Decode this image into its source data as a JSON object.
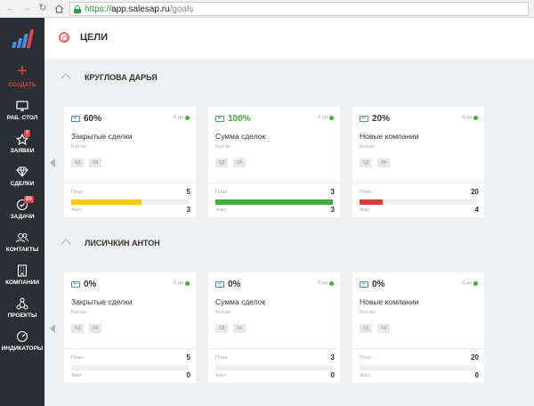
{
  "browser": {
    "url_scheme": "https://",
    "url_host": "app.salesap.ru",
    "url_path": "/goals"
  },
  "sidebar": {
    "create_label": "СОЗДАТЬ",
    "items": [
      {
        "label": "РАБ. СТОЛ",
        "icon": "monitor-icon"
      },
      {
        "label": "ЗАЯВКИ",
        "icon": "star-icon",
        "badge": "7"
      },
      {
        "label": "СДЕЛКИ",
        "icon": "diamond-icon"
      },
      {
        "label": "ЗАДАЧИ",
        "icon": "check-circle-icon",
        "badge": "85"
      },
      {
        "label": "КОНТАКТЫ",
        "icon": "users-icon"
      },
      {
        "label": "КОМПАНИИ",
        "icon": "building-icon"
      },
      {
        "label": "ПРОЕКТЫ",
        "icon": "projects-icon"
      },
      {
        "label": "ИНДИКАТОРЫ",
        "icon": "gauge-icon"
      }
    ]
  },
  "page": {
    "title": "ЦЕЛИ"
  },
  "sections": [
    {
      "name": "КРУГЛОВА ДАРЬЯ",
      "cards": [
        {
          "percent": "60%",
          "percent_color": "#333333",
          "period": "8 дн",
          "name": "Закрытые сделки",
          "unit": "Кол-во",
          "tags": [
            "ХД",
            "ЛА"
          ],
          "plan_label": "План",
          "plan": "5",
          "fact_label": "Факт",
          "fact": "3",
          "progress": 0.6,
          "bar_color": "#f5c518"
        },
        {
          "percent": "100%",
          "percent_color": "#3fae3c",
          "period": "8 дн",
          "name": "Сумма сделок",
          "unit": "Кол-во",
          "tags": [
            "ХД",
            "ЛА"
          ],
          "plan_label": "План",
          "plan": "3",
          "fact_label": "Факт",
          "fact": "3",
          "progress": 1.0,
          "bar_color": "#3fae3c"
        },
        {
          "percent": "20%",
          "percent_color": "#333333",
          "period": "8 дн",
          "name": "Новые компании",
          "unit": "Кол-во",
          "tags": [
            "ХД",
            "ЛА"
          ],
          "plan_label": "План",
          "plan": "20",
          "fact_label": "Факт",
          "fact": "4",
          "progress": 0.2,
          "bar_color": "#e03a3a"
        }
      ]
    },
    {
      "name": "ЛИСИЧКИН АНТОН",
      "cards": [
        {
          "percent": "0%",
          "percent_color": "#333333",
          "period": "8 дн",
          "name": "Закрытые сделки",
          "unit": "Кол-во",
          "tags": [
            "ХД",
            "ЛА"
          ],
          "plan_label": "План",
          "plan": "5",
          "fact_label": "Факт",
          "fact": "0",
          "progress": 0.0,
          "bar_color": "#f5c518"
        },
        {
          "percent": "0%",
          "percent_color": "#333333",
          "period": "8 дн",
          "name": "Сумма сделок",
          "unit": "Кол-во",
          "tags": [
            "ХД",
            "ЛА"
          ],
          "plan_label": "План",
          "plan": "3",
          "fact_label": "Факт",
          "fact": "0",
          "progress": 0.0,
          "bar_color": "#3fae3c"
        },
        {
          "percent": "0%",
          "percent_color": "#333333",
          "period": "8 дн",
          "name": "Новые компании",
          "unit": "Кол-во",
          "tags": [
            "ХД",
            "ЛА"
          ],
          "plan_label": "План",
          "plan": "20",
          "fact_label": "Факт",
          "fact": "0",
          "progress": 0.0,
          "bar_color": "#e03a3a"
        }
      ]
    }
  ]
}
